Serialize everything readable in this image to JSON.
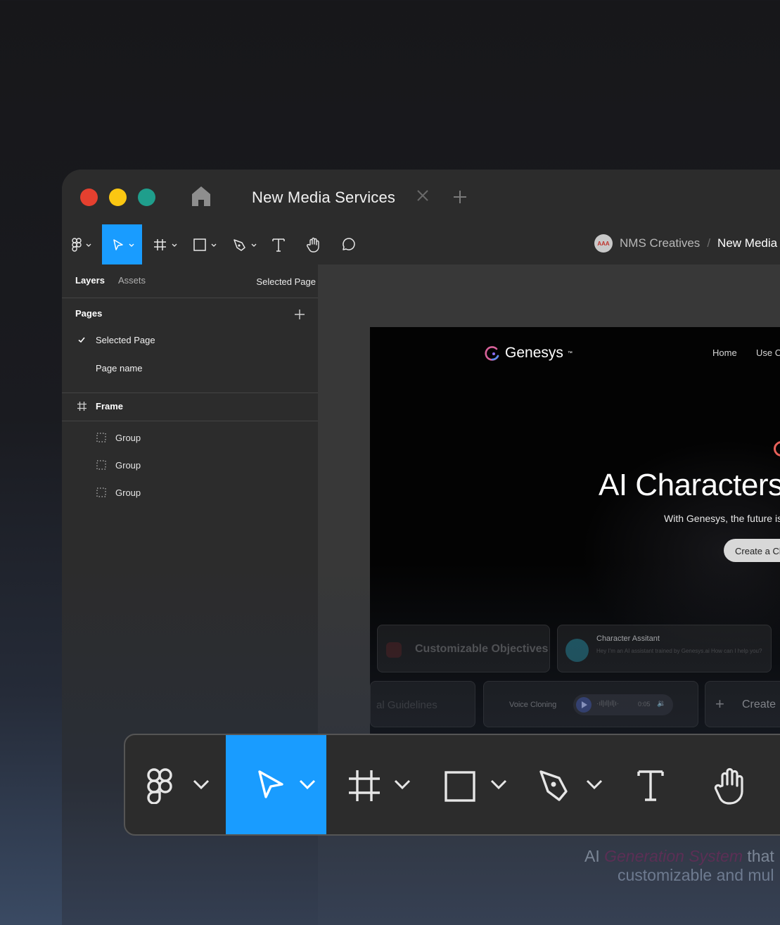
{
  "window": {
    "tab_title": "New Media Services"
  },
  "toolbar": {
    "tools": [
      "figma-menu",
      "move",
      "frame",
      "shape",
      "pen",
      "text",
      "hand",
      "comment"
    ],
    "active_tool": "move",
    "accent_color": "#199cff"
  },
  "breadcrumb": {
    "avatar_text": "AAA",
    "team": "NMS Creatives",
    "separator": "/",
    "file": "New Media"
  },
  "sidebar": {
    "tabs": {
      "layers": "Layers",
      "assets": "Assets"
    },
    "current_page": "Selected Page",
    "pages_heading": "Pages",
    "pages": [
      {
        "label": "Selected Page",
        "selected": true
      },
      {
        "label": "Page name",
        "selected": false
      }
    ],
    "frame_label": "Frame",
    "groups": [
      "Group",
      "Group",
      "Group"
    ]
  },
  "design": {
    "brand": "Genesys",
    "brand_mark": "™",
    "nav": [
      "Home",
      "Use C"
    ],
    "hero_title": "AI Characters",
    "hero_subtitle": "With Genesys, the future is",
    "hero_button": "Create a Cl",
    "cards": {
      "objectives": "Customizable Objectives",
      "assistant_title": "Character Assitant",
      "assistant_body": "Hey I'm an AI assistant trained by Genesys.ai How can I help you?",
      "guidelines": "al Guidelines",
      "voice_label": "Voice Cloning",
      "voice_time": "0:05",
      "create": "Create"
    }
  },
  "tagline": {
    "line1_prefix": "AI ",
    "line1_accent": "Generation System",
    "line1_suffix": " that",
    "line2": "customizable and mul"
  }
}
